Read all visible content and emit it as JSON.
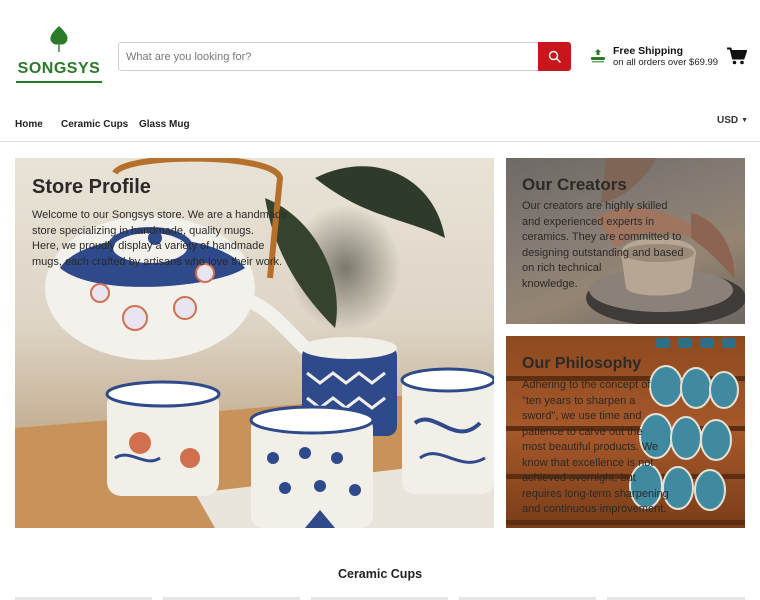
{
  "brand": {
    "name": "SONGSYS",
    "color": "#2a7a2a"
  },
  "search": {
    "placeholder": "What are you looking for?",
    "button_color": "#c8161d"
  },
  "shipping": {
    "title": "Free Shipping",
    "subtitle": "on all orders over $69.99"
  },
  "nav": {
    "items": [
      "Home",
      "Ceramic Cups",
      "Glass Mug"
    ],
    "currency": "USD"
  },
  "banners": {
    "main": {
      "title": "Store Profile",
      "lines": [
        "Welcome to our Songsys store. We are a handmade",
        "store specializing in handmade, quality mugs.",
        "Here, we proudly display a variety of handmade",
        "mugs, each crafted by artisans who love their work."
      ]
    },
    "creators": {
      "title": "Our Creators",
      "lines": [
        "Our creators are highly skilled",
        "and experienced experts in",
        "ceramics. They are committed to",
        "designing outstanding and based",
        "on rich technical",
        "knowledge."
      ]
    },
    "philosophy": {
      "title": "Our Philosophy",
      "lines": [
        "Adhering to the concept of",
        "\"ten years to sharpen a",
        "sword\", we use time and",
        "patience to carve out the",
        "most beautiful products. We",
        "know that excellence is not",
        "achieved overnight, but",
        "requires long-term sharpening",
        "and continuous improvement."
      ]
    }
  },
  "section": {
    "title": "Ceramic Cups"
  },
  "icons": {
    "logo": "leaf-icon",
    "search": "search-icon",
    "shipping": "truck-icon",
    "cart": "cart-icon",
    "currency": "chevron-down-icon"
  }
}
